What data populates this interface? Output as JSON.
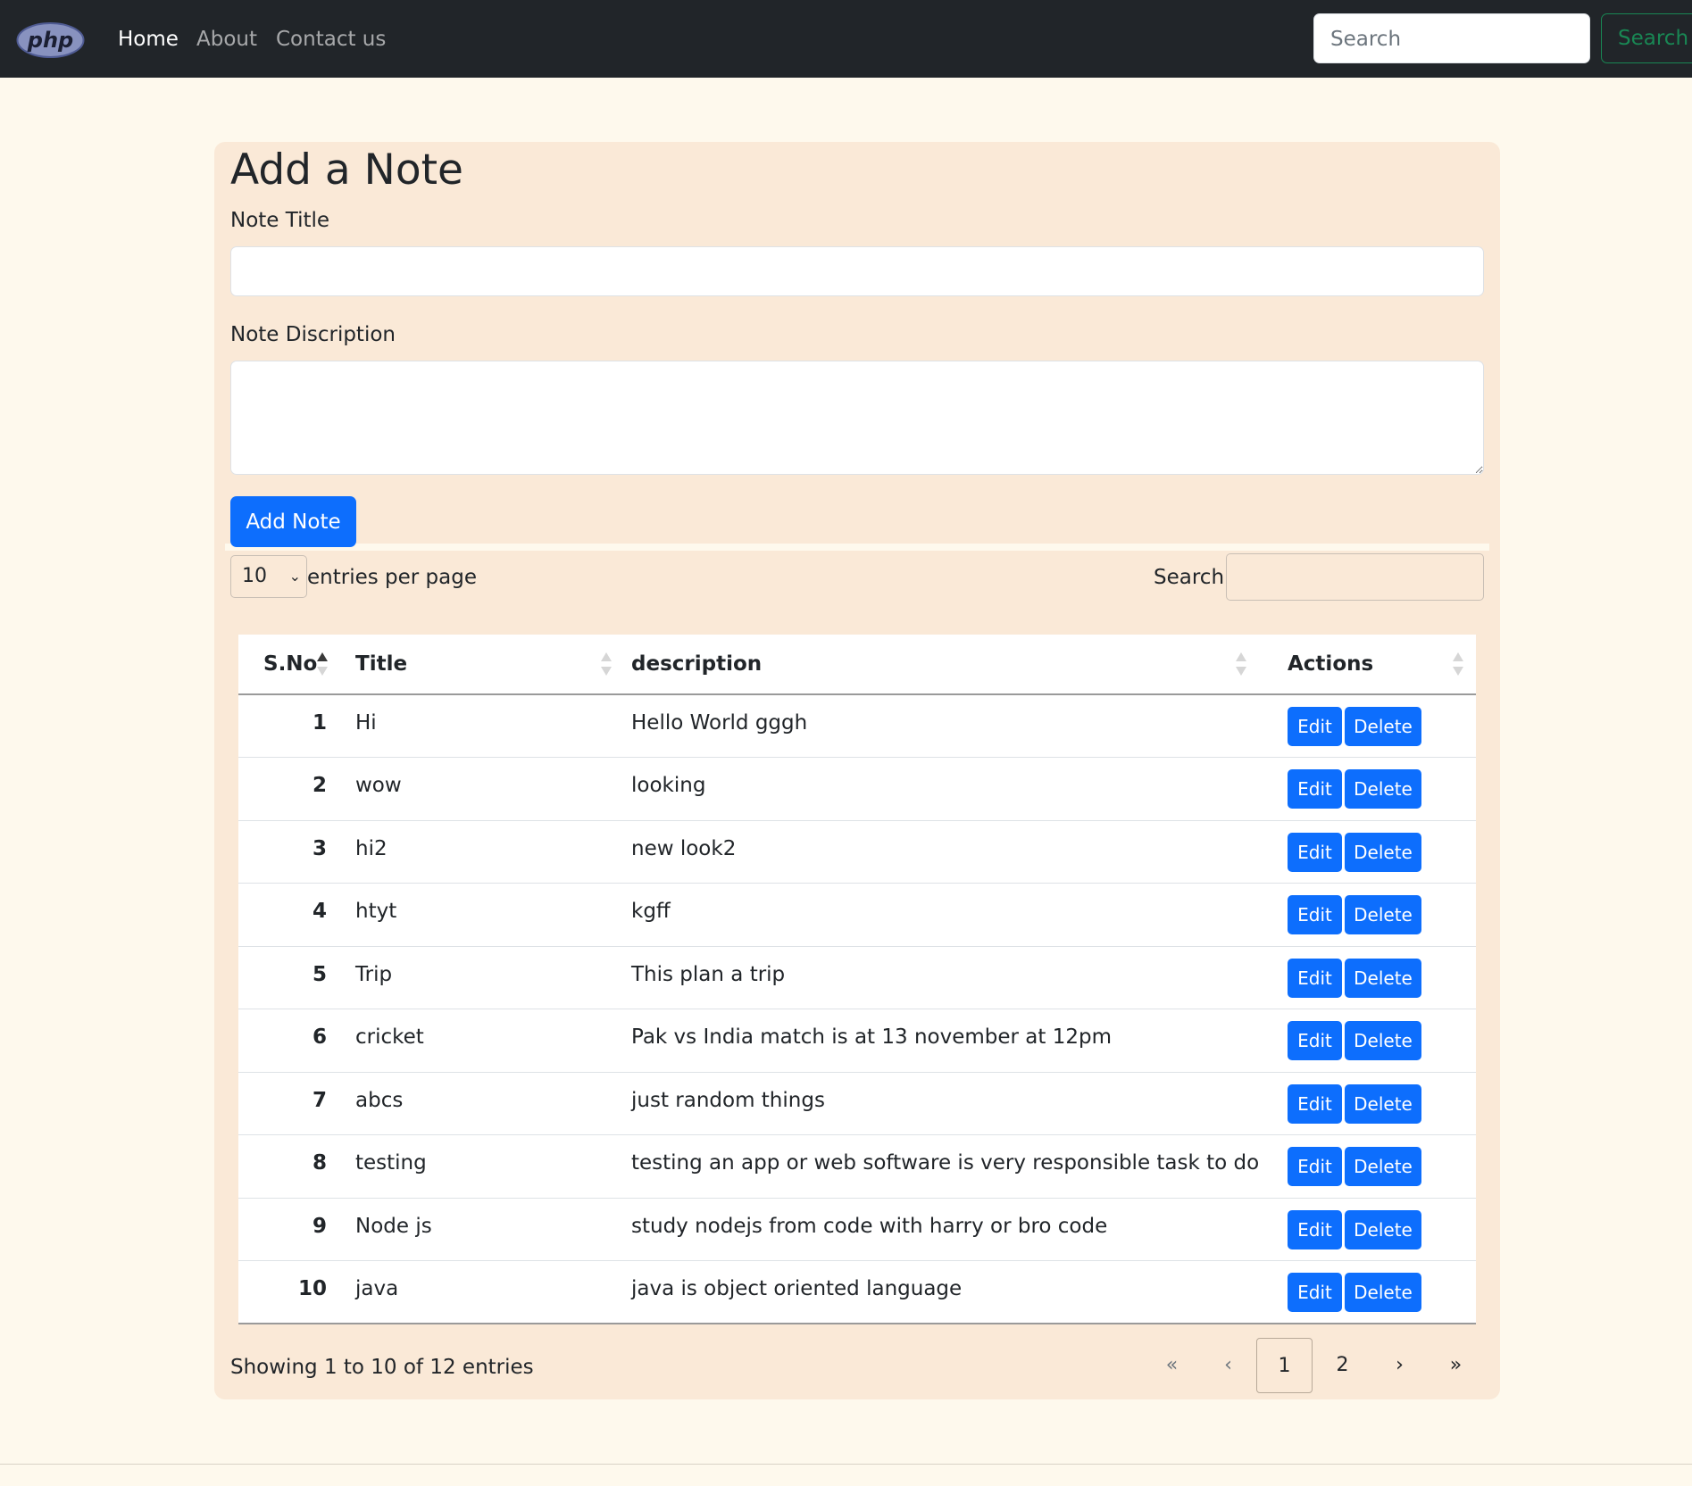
{
  "navbar": {
    "logo_text": "php",
    "links": [
      {
        "label": "Home",
        "active": true
      },
      {
        "label": "About",
        "active": false
      },
      {
        "label": "Contact us",
        "active": false
      }
    ],
    "search_placeholder": "Search",
    "search_button": "Search"
  },
  "form": {
    "heading": "Add a Note",
    "title_label": "Note Title",
    "title_value": "",
    "description_label": "Note Discription",
    "description_value": "",
    "submit_label": "Add Note"
  },
  "datatable": {
    "page_length": "10",
    "entries_label": "entries per page",
    "search_label": "Search:",
    "search_value": "",
    "columns": [
      "S.No",
      "Title",
      "description",
      "Actions"
    ],
    "rows": [
      {
        "sno": "1",
        "title": "Hi",
        "description": "Hello World gggh"
      },
      {
        "sno": "2",
        "title": "wow",
        "description": "looking"
      },
      {
        "sno": "3",
        "title": "hi2",
        "description": "new look2"
      },
      {
        "sno": "4",
        "title": "htyt",
        "description": "kgff"
      },
      {
        "sno": "5",
        "title": "Trip",
        "description": "This plan a trip"
      },
      {
        "sno": "6",
        "title": "cricket",
        "description": "Pak vs India match is at 13 november at 12pm"
      },
      {
        "sno": "7",
        "title": "abcs",
        "description": "just random things"
      },
      {
        "sno": "8",
        "title": "testing",
        "description": "testing an app or web software is very responsible task to do"
      },
      {
        "sno": "9",
        "title": "Node js",
        "description": "study nodejs from code with harry or bro code"
      },
      {
        "sno": "10",
        "title": "java",
        "description": "java is object oriented language"
      }
    ],
    "edit_label": "Edit",
    "delete_label": "Delete",
    "info": "Showing 1 to 10 of 12 entries",
    "pagination": {
      "first": "«",
      "prev": "‹",
      "pages": [
        "1",
        "2"
      ],
      "current": "1",
      "next": "›",
      "last": "»"
    }
  },
  "colors": {
    "navbar_bg": "#212529",
    "page_bg": "#fef9ed",
    "card_bg": "#fae9d7",
    "primary": "#0d6efd",
    "success": "#198754"
  }
}
